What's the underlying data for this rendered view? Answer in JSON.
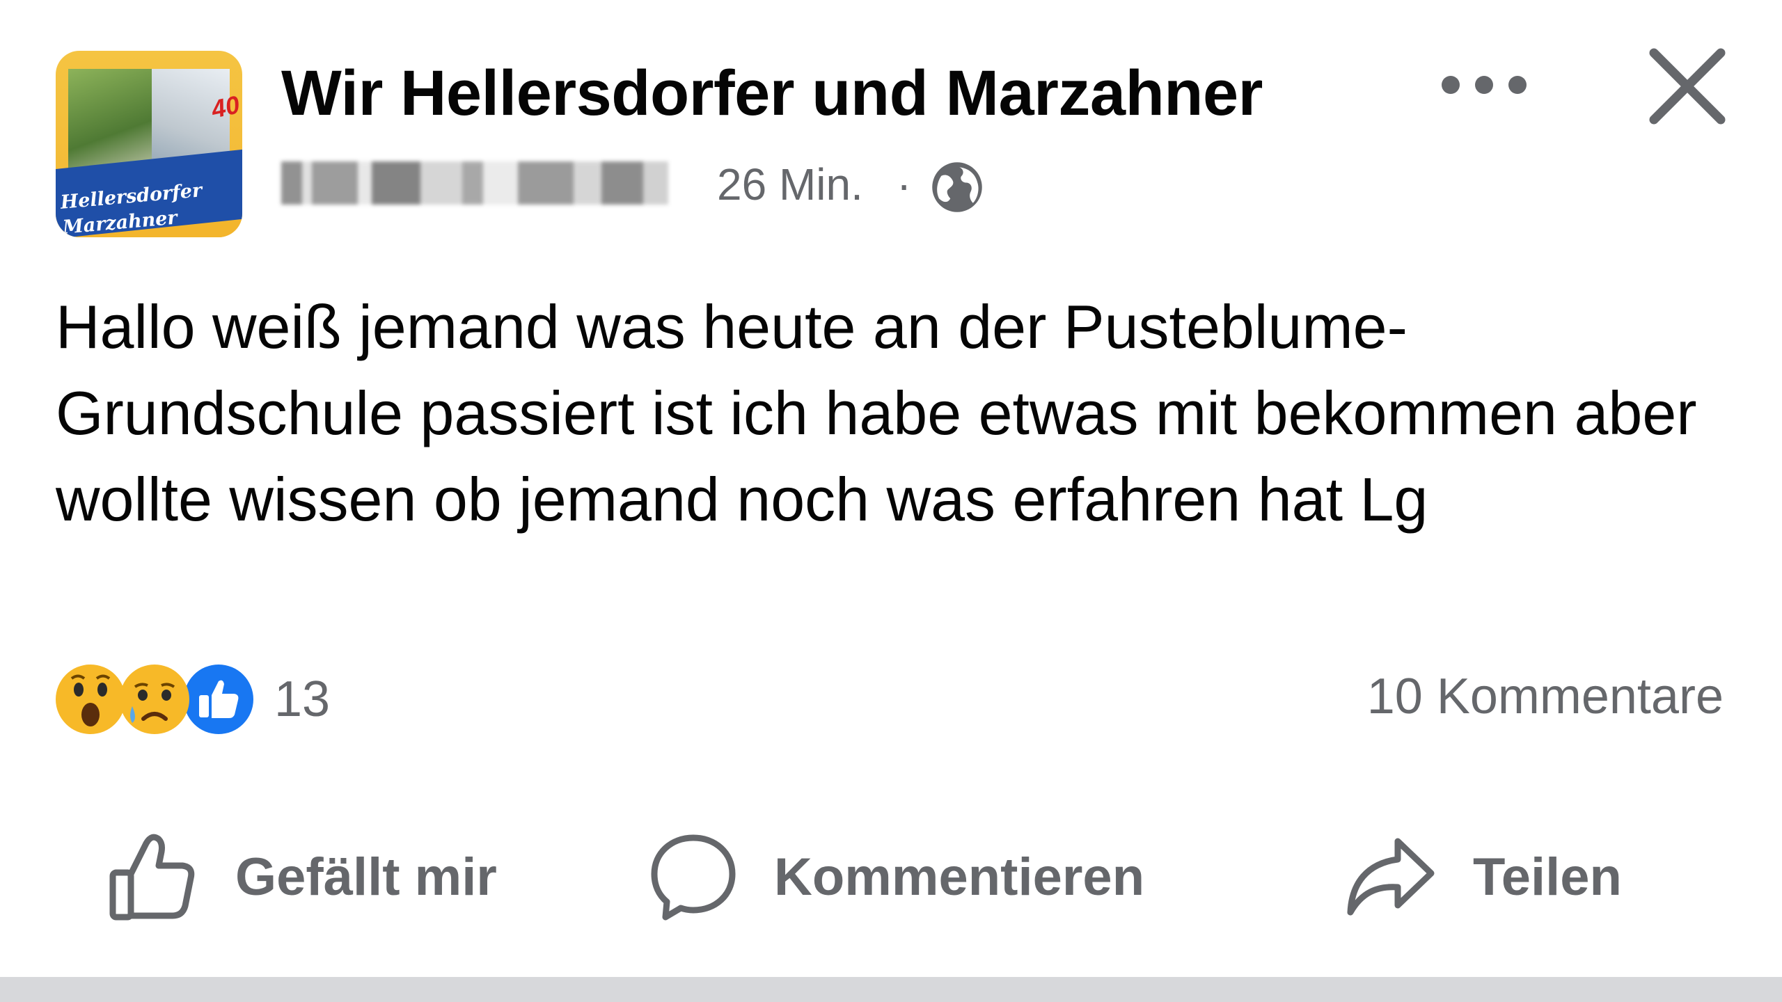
{
  "post": {
    "group_name": "Wir Hellersdorfer und Marzahner",
    "avatar": {
      "line1": "Hellersdorfer",
      "line2": "Marzahner",
      "badge": "40"
    },
    "time": "26 Min.",
    "separator": "·",
    "privacy_icon": "globe-icon",
    "text": "Hallo weiß jemand was heute an der Pusteblume-Grundschule passiert ist ich habe etwas mit bekommen aber wollte wissen ob jemand noch was erfahren hat Lg"
  },
  "header_actions": {
    "more_icon": "more-icon",
    "close_icon": "close-icon"
  },
  "reactions": {
    "icons": [
      "wow-reaction-icon",
      "sad-reaction-icon",
      "like-reaction-icon"
    ],
    "count": "13"
  },
  "comments": {
    "count_label": "10 Kommentare"
  },
  "actions": {
    "like_label": "Gefällt mir",
    "comment_label": "Kommentieren",
    "share_label": "Teilen"
  },
  "colors": {
    "primary_text": "#050505",
    "secondary_text": "#65676b",
    "like_blue": "#1877f2",
    "reaction_yellow": "#f7b928"
  }
}
